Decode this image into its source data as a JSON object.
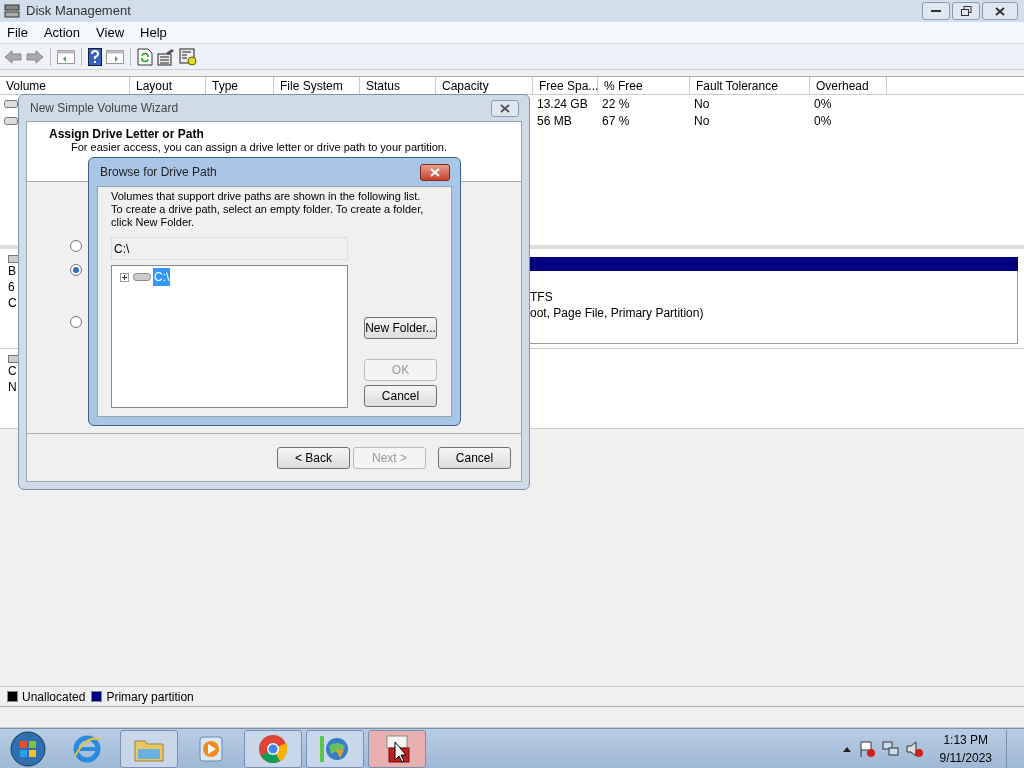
{
  "window": {
    "title": "Disk Management"
  },
  "menu": [
    "File",
    "Action",
    "View",
    "Help"
  ],
  "volume_list": {
    "columns": [
      "Volume",
      "Layout",
      "Type",
      "File System",
      "Status",
      "Capacity",
      "Free Spa...",
      "% Free",
      "Fault Tolerance",
      "Overhead"
    ],
    "rows": [
      {
        "cells": [
          "13.24 GB",
          "22 %",
          "No",
          "0%"
        ]
      },
      {
        "cells": [
          "56 MB",
          "67 %",
          "No",
          "0%"
        ]
      }
    ]
  },
  "disk_pane": {
    "disks": [
      {
        "label_lines": [
          "B",
          "6",
          "C"
        ],
        "partition": {
          "color": "#000080",
          "lines": [
            "TFS",
            "oot, Page File, Primary Partition)"
          ]
        }
      },
      {
        "label_lines": [
          "C",
          "N"
        ]
      }
    ]
  },
  "legend": [
    {
      "label": "Unallocated",
      "color": "#000000"
    },
    {
      "label": "Primary partition",
      "color": "#000080"
    }
  ],
  "wizard": {
    "title": "New Simple Volume Wizard",
    "heading": "Assign Drive Letter or Path",
    "description": "For easier access, you can assign a drive letter or drive path to your partition.",
    "options": [
      {
        "selected": false
      },
      {
        "selected": true
      },
      {
        "selected": false
      }
    ],
    "buttons": [
      {
        "label": "< Back",
        "disabled": false
      },
      {
        "label": "Next >",
        "disabled": true
      },
      {
        "label": "Cancel",
        "disabled": false
      }
    ]
  },
  "browse_dialog": {
    "title": "Browse for Drive Path",
    "instructions": "Volumes that support drive paths are shown in the following list.\nTo create a drive path, select an empty folder. To create a folder, click New Folder.",
    "path": "C:\\",
    "tree": [
      {
        "label": "C:\\",
        "selected": true,
        "expanded": false
      }
    ],
    "buttons": [
      {
        "label": "New Folder...",
        "disabled": false
      },
      {
        "label": "OK",
        "disabled": true
      },
      {
        "label": "Cancel",
        "disabled": false
      }
    ]
  },
  "taskbar": {
    "apps": [
      {
        "kind": "browser-e",
        "running": false,
        "active": false
      },
      {
        "kind": "folder",
        "running": true,
        "active": false
      },
      {
        "kind": "media",
        "running": false,
        "active": false
      },
      {
        "kind": "chrome",
        "running": true,
        "active": false
      },
      {
        "kind": "globe",
        "running": true,
        "active": false
      },
      {
        "kind": "toolbox",
        "running": true,
        "active": true
      }
    ],
    "time": "1:13 PM",
    "date": "9/11/2023"
  }
}
